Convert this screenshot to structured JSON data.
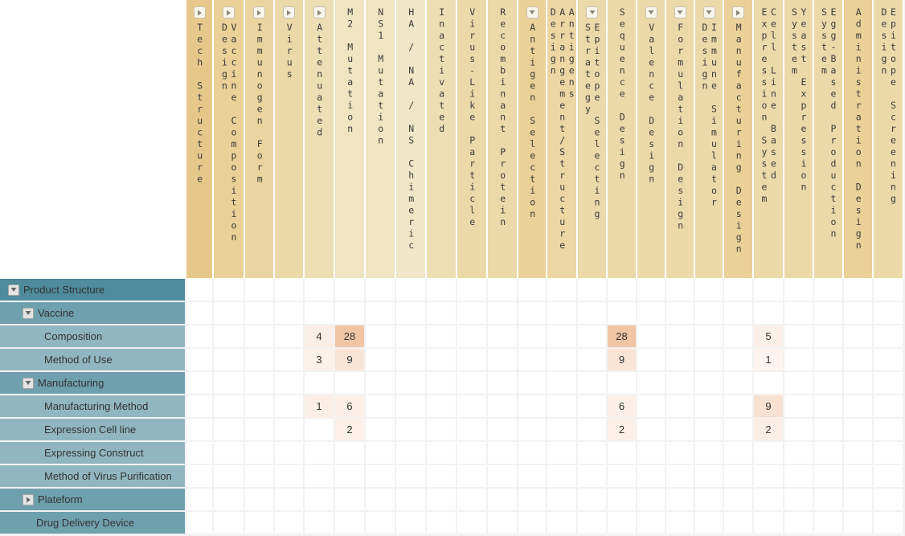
{
  "colors": {
    "row_level1": "#4f8b9b",
    "row_level2": "#6ea0ae",
    "row_level3": "#92b6c1",
    "grid_line": "#f2f2f2",
    "cell_bg": "#ffffff",
    "heat_low": "#fbeee6",
    "heat_high": "#f0c5a4"
  },
  "columns": [
    {
      "label": "Tech Structure",
      "toggle": "right",
      "width": 34,
      "bg": "#e6c98a"
    },
    {
      "label": "Vaccine Composition Design",
      "toggle": "right",
      "width": 39,
      "bg": "#e9d197"
    },
    {
      "label": "Immunogen Form",
      "toggle": "right",
      "width": 37,
      "bg": "#ead5a0"
    },
    {
      "label": "Virus",
      "toggle": "right",
      "width": 37,
      "bg": "#ecd9a9"
    },
    {
      "label": "Attenuated",
      "toggle": "right",
      "width": 38,
      "bg": "#eedeb4"
    },
    {
      "label": "M2 Mutation",
      "toggle": "none",
      "width": 38,
      "bg": "#f0e4c2"
    },
    {
      "label": "NS1 Mutation",
      "toggle": "none",
      "width": 38,
      "bg": "#f0e4c2"
    },
    {
      "label": "HA / NA / NS Chimeric",
      "toggle": "none",
      "width": 38,
      "bg": "#f1e6c7"
    },
    {
      "label": "Inactivated",
      "toggle": "none",
      "width": 38,
      "bg": "#eedeb4"
    },
    {
      "label": "Virus-Like Particle",
      "toggle": "none",
      "width": 38,
      "bg": "#ecd9a9"
    },
    {
      "label": "Recombinant Protein",
      "toggle": "none",
      "width": 38,
      "bg": "#ecd9a9"
    },
    {
      "label": "Antigen Selection",
      "toggle": "down",
      "width": 36,
      "bg": "#e9d197"
    },
    {
      "label": "Antigens Arrangement/Structure Design",
      "toggle": "none",
      "width": 38,
      "bg": "#ebd6a4"
    },
    {
      "label": "Epitope Selecting Strategy",
      "toggle": "down",
      "width": 37,
      "bg": "#ecd9a9"
    },
    {
      "label": "Sequence Design",
      "toggle": "none",
      "width": 37,
      "bg": "#ecd9a9"
    },
    {
      "label": "Valence Design",
      "toggle": "down",
      "width": 36,
      "bg": "#ecd9a9"
    },
    {
      "label": "Formulation Design",
      "toggle": "down",
      "width": 36,
      "bg": "#ecd9a9"
    },
    {
      "label": "Immune Simulator Design",
      "toggle": "down",
      "width": 36,
      "bg": "#ecd9a9"
    },
    {
      "label": "Manufacturing Design",
      "toggle": "right",
      "width": 37,
      "bg": "#e9d197"
    },
    {
      "label": "Cell Line Based Expression System",
      "toggle": "none",
      "width": 38,
      "bg": "#ecd9a9"
    },
    {
      "label": "Yeast Expression System",
      "toggle": "none",
      "width": 37,
      "bg": "#ecd9a9"
    },
    {
      "label": "Egg-Based Production System",
      "toggle": "none",
      "width": 37,
      "bg": "#ecd9a9"
    },
    {
      "label": "Administration Design",
      "toggle": "none",
      "width": 37,
      "bg": "#e9d197"
    },
    {
      "label": "Epitope Screening Design",
      "toggle": "none",
      "width": 38,
      "bg": "#ecd9a9"
    }
  ],
  "rows": [
    {
      "label": "Product Structure",
      "level": 1,
      "toggle": "down",
      "indent": 10
    },
    {
      "label": "Vaccine",
      "level": 2,
      "toggle": "down",
      "indent": 28
    },
    {
      "label": "Composition",
      "level": 3,
      "toggle": "none",
      "indent": 55
    },
    {
      "label": "Method of Use",
      "level": 3,
      "toggle": "none",
      "indent": 55
    },
    {
      "label": "Manufacturing",
      "level": 2,
      "toggle": "down",
      "indent": 28
    },
    {
      "label": "Manufacturing Method",
      "level": 3,
      "toggle": "none",
      "indent": 55
    },
    {
      "label": "Expression Cell line",
      "level": 3,
      "toggle": "none",
      "indent": 55
    },
    {
      "label": "Expressing Construct",
      "level": 3,
      "toggle": "none",
      "indent": 55
    },
    {
      "label": "Method of Virus Purification",
      "level": 3,
      "toggle": "none",
      "indent": 55
    },
    {
      "label": "Plateform",
      "level": 2,
      "toggle": "right",
      "indent": 28
    },
    {
      "label": "Drug Delivery Device",
      "level": 2,
      "toggle": "none",
      "indent": 45
    }
  ],
  "cells": [
    {
      "row": 2,
      "col": 4,
      "value": "4",
      "bg": "#fbeee6"
    },
    {
      "row": 2,
      "col": 5,
      "value": "28",
      "bg": "#f0c5a4"
    },
    {
      "row": 2,
      "col": 14,
      "value": "28",
      "bg": "#f0c5a4"
    },
    {
      "row": 2,
      "col": 19,
      "value": "5",
      "bg": "#fbf0e9"
    },
    {
      "row": 3,
      "col": 4,
      "value": "3",
      "bg": "#fcf1ea"
    },
    {
      "row": 3,
      "col": 5,
      "value": "9",
      "bg": "#f9e4d6"
    },
    {
      "row": 3,
      "col": 14,
      "value": "9",
      "bg": "#f9e4d6"
    },
    {
      "row": 3,
      "col": 19,
      "value": "1",
      "bg": "#fdf4ef"
    },
    {
      "row": 5,
      "col": 4,
      "value": "1",
      "bg": "#fbeee6"
    },
    {
      "row": 5,
      "col": 5,
      "value": "6",
      "bg": "#fbefe8"
    },
    {
      "row": 5,
      "col": 14,
      "value": "6",
      "bg": "#fbefe8"
    },
    {
      "row": 5,
      "col": 19,
      "value": "9",
      "bg": "#f8e1d1"
    },
    {
      "row": 6,
      "col": 5,
      "value": "2",
      "bg": "#fcf1ea"
    },
    {
      "row": 6,
      "col": 14,
      "value": "2",
      "bg": "#fcf1ea"
    },
    {
      "row": 6,
      "col": 19,
      "value": "2",
      "bg": "#fbeee6"
    }
  ]
}
